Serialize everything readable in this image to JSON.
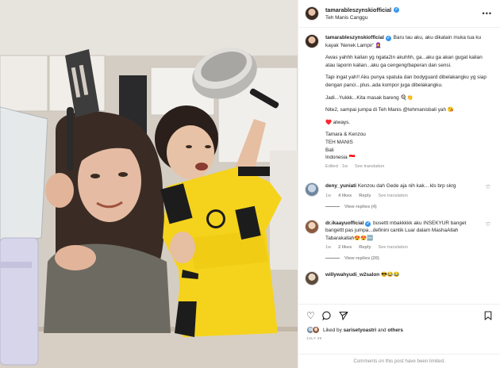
{
  "post": {
    "username": "tamarableszynskiofficial",
    "location": "Teh Manis Canggu",
    "more_icon": "more-options-icon"
  },
  "caption": {
    "username": "tamarableszynskiofficial",
    "p1": " Baru tau aku, aku dikatain muka tua ku kayak 'Nenek Lampir' 🧕",
    "p2": "Awas yahhh kalian yg ngata2in akuhhh, ga...aku ga akan gugat kalian atau laporin kalian...aku ga cengeng/baperan dan sensi.",
    "p3": "Tapi ingat yah!! Aku punya spatula dan bodyguard dibelakangku yg siap dengan panci...plus..ada kompor juga dibelakangku.",
    "p4": "Jadi...Yukkk...Kita masak bareng 🍳👏",
    "p5": "Nite2, sampai jumpa di Teh Manis @tehmanisbali yah 😘",
    "p6": "♥️ always.",
    "sig1": "Tamara & Kenzou",
    "sig2": "TEH MANIS",
    "sig3": "Bali",
    "sig4": "Indonesia 🇮🇩",
    "meta_edited": "Edited · 1w",
    "meta_translate": "See translation"
  },
  "comments": [
    {
      "username": "deny_yuniati",
      "text": " Kenzou dah Gede aja nih kak... kls brp skrg",
      "age": "1w",
      "likes": "4 likes",
      "reply": "Reply",
      "translate": "See translation",
      "view_replies": "View replies (4)"
    },
    {
      "username": "dr.ikaayuofficial",
      "text": " busettt mbakkkkk aku INSEKYUR banget bangettt pas jumpa...definini cantik Luar dalam MashaAllah Tabarakallah😍😍🆒",
      "age": "1w",
      "likes": "2 likes",
      "reply": "Reply",
      "translate": "See translation",
      "view_replies": "View replies (20)"
    },
    {
      "username": "willywahyudi_w2salon",
      "text": " 😎😂😂"
    }
  ],
  "actions": {
    "like_icon": "heart-icon",
    "comment_icon": "comment-icon",
    "share_icon": "share-icon",
    "save_icon": "bookmark-icon",
    "liked_by_prefix": "Liked by ",
    "liked_by_user": "sarisetyoastri",
    "liked_by_and": " and ",
    "liked_by_others": "others",
    "date": "JULY 29"
  },
  "footer": {
    "limited": "Comments on this post have been limited."
  },
  "colors": {
    "verified": "#3897f0",
    "muted": "#8e8e8e",
    "jersey_yellow": "#f5d31c"
  }
}
